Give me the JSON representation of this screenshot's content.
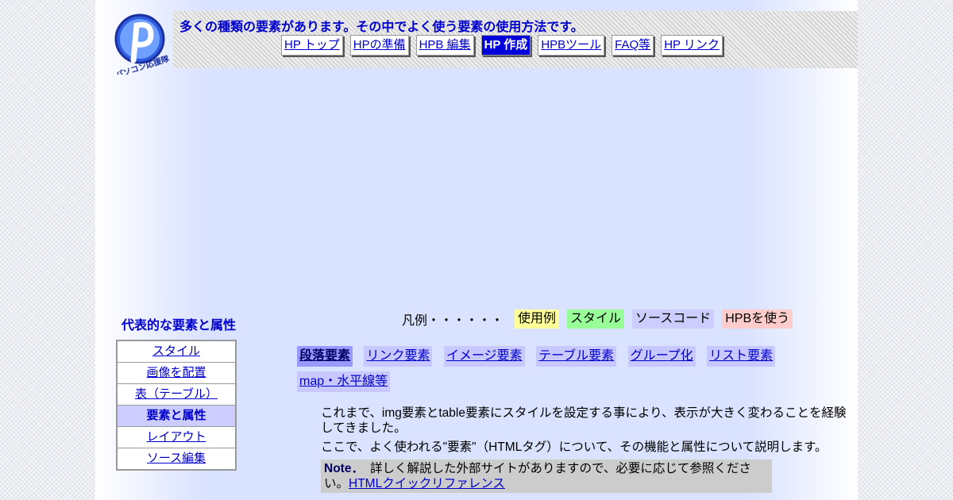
{
  "header": {
    "title": "多くの種類の要素があります。その中でよく使う要素の使用方法です。",
    "logo_text": "パソコン応援隊",
    "nav": [
      {
        "label": "HP トップ"
      },
      {
        "label": "HPの準備"
      },
      {
        "label": "HPB 編集"
      },
      {
        "label": "HP 作成",
        "active": true
      },
      {
        "label": "HPBツール"
      },
      {
        "label": "FAQ等"
      },
      {
        "label": "HP リンク"
      }
    ]
  },
  "sidebar": {
    "title": "代表的な要素と属性",
    "items": [
      {
        "label": "スタイル"
      },
      {
        "label": "画像を配置"
      },
      {
        "label": "表（テーブル）"
      },
      {
        "label": "要素と属性",
        "active": true
      },
      {
        "label": "レイアウト"
      },
      {
        "label": "ソース編集"
      }
    ]
  },
  "legend": {
    "label": "凡例・・・・・・",
    "chips": [
      "使用例",
      "スタイル",
      "ソースコード",
      "HPBを使う"
    ]
  },
  "subnav": [
    {
      "label": "段落要素",
      "active": true
    },
    {
      "label": "リンク要素"
    },
    {
      "label": "イメージ要素"
    },
    {
      "label": "テーブル要素"
    },
    {
      "label": "グループ化"
    },
    {
      "label": "リスト要素"
    },
    {
      "label": "map・水平線等"
    }
  ],
  "content": {
    "para1": "これまで、img要素とtable要素にスタイルを設定する事により、表示が大きく変わることを経験してきました。",
    "para2": "ここで、よく使われる\"要素\"（HTMLタグ）について、その機能と属性について説明します。",
    "note_label": "Note．",
    "note_text": "詳しく解説した外部サイトがありますので、必要に応じて参照ください。",
    "note_link": "HTMLクイックリファレンス"
  },
  "colors": {
    "accent": "#0000cc",
    "active_nav": "#0000dd",
    "legend_yellow": "#ffff99",
    "legend_green": "#99ff99",
    "legend_purple": "#ccccff",
    "legend_pink": "#ffcccc"
  }
}
